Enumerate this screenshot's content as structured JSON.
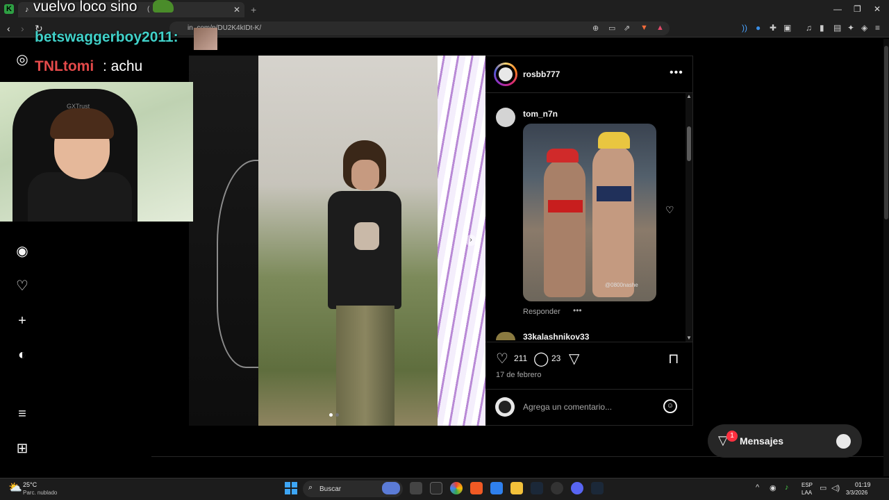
{
  "browser": {
    "tab_title": "(",
    "url": "in        .com/p/DU2K4kIDt-K/"
  },
  "overlay": {
    "title": "vuelvo loco sino",
    "chat": [
      {
        "user": "betswaggerboy2011:",
        "message": ""
      },
      {
        "user": "TNLtomi",
        "message": ": achu"
      }
    ]
  },
  "webcam": {
    "chair_brand": "GXTrust"
  },
  "sidebar": {
    "items": [
      {
        "name": "instagram-logo-icon",
        "glyph": "◎"
      },
      {
        "name": "explore-icon",
        "glyph": "◉"
      },
      {
        "name": "notifications-icon",
        "glyph": "♡"
      },
      {
        "name": "create-icon",
        "glyph": "+"
      },
      {
        "name": "profile-icon",
        "glyph": "◐"
      },
      {
        "name": "menu-icon",
        "glyph": "≡"
      },
      {
        "name": "threads-icon",
        "glyph": "⊞"
      }
    ]
  },
  "post": {
    "username": "rosbb777",
    "comment": {
      "user": "tom_n7n",
      "watermark": "@0800nashe",
      "reply": "Responder"
    },
    "next_comment_user": "33kalashnikov33",
    "likes": "211",
    "comments": "23",
    "date": "17 de febrero",
    "comment_placeholder": "Agrega un comentario..."
  },
  "messages": {
    "label": "Mensajes",
    "badge": "1"
  },
  "taskbar": {
    "weather_temp": "25°C",
    "weather_desc": "Parc. nublado",
    "search_label": "Buscar",
    "lang1": "ESP",
    "lang2": "LAA",
    "time": "01:19",
    "date": "3/3/2026"
  },
  "colors": {
    "accent_chat_1": "#41d1c9",
    "accent_chat_2": "#e44a4a",
    "badge": "#ff3040",
    "panel_bg": "#000000"
  }
}
